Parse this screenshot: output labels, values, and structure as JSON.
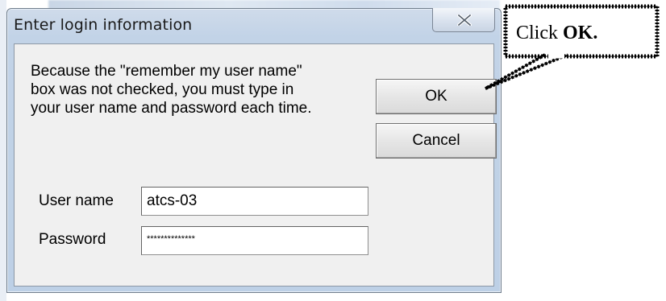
{
  "dialog": {
    "title": "Enter login information",
    "close_icon": "close-icon",
    "message_lines": [
      "Because the \"remember my user name\"",
      "box was not checked, you must type in",
      "your user name and password each time."
    ],
    "ok_label": "OK",
    "cancel_label": "Cancel",
    "user_name_label": "User name",
    "user_name_value": "atcs-03",
    "password_label": "Password",
    "password_value": "**************"
  },
  "callout": {
    "text_prefix": "Click",
    "text_bold": "OK."
  },
  "colors": {
    "title_bar": "#c2d3e7",
    "client_bg": "#f0f0f0",
    "button_border": "#707070"
  }
}
